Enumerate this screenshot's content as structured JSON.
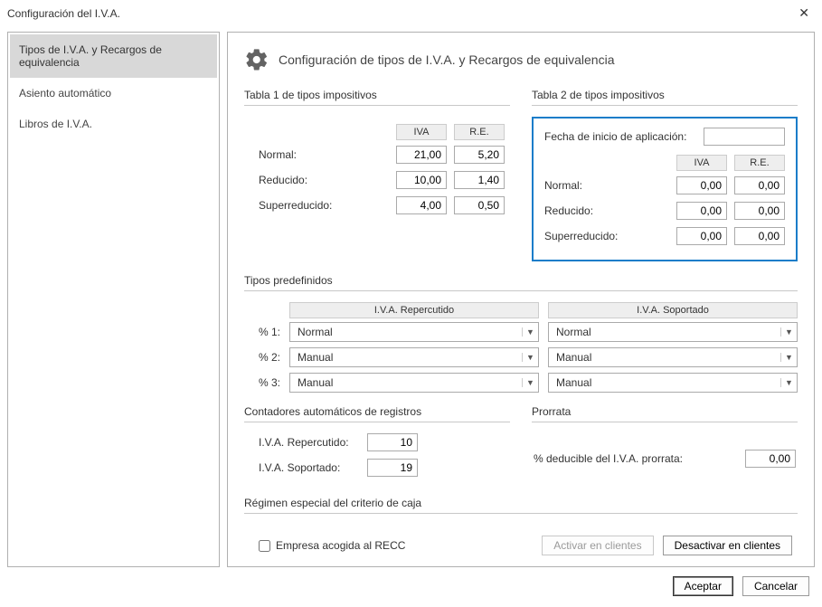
{
  "window": {
    "title": "Configuración del I.V.A."
  },
  "sidebar": {
    "items": [
      {
        "label": "Tipos de I.V.A. y Recargos de equivalencia",
        "selected": true
      },
      {
        "label": "Asiento automático",
        "selected": false
      },
      {
        "label": "Libros de I.V.A.",
        "selected": false
      }
    ]
  },
  "header": {
    "title": "Configuración de tipos de I.V.A. y Recargos de equivalencia"
  },
  "table1": {
    "title": "Tabla 1 de tipos impositivos",
    "cols": {
      "iva": "IVA",
      "re": "R.E."
    },
    "rows": {
      "normal": {
        "label": "Normal:",
        "iva": "21,00",
        "re": "5,20"
      },
      "reducido": {
        "label": "Reducido:",
        "iva": "10,00",
        "re": "1,40"
      },
      "super": {
        "label": "Superreducido:",
        "iva": "4,00",
        "re": "0,50"
      }
    }
  },
  "table2": {
    "title": "Tabla 2 de tipos impositivos",
    "start_label": "Fecha de inicio de aplicación:",
    "start_value": "",
    "cols": {
      "iva": "IVA",
      "re": "R.E."
    },
    "rows": {
      "normal": {
        "label": "Normal:",
        "iva": "0,00",
        "re": "0,00"
      },
      "reducido": {
        "label": "Reducido:",
        "iva": "0,00",
        "re": "0,00"
      },
      "super": {
        "label": "Superreducido:",
        "iva": "0,00",
        "re": "0,00"
      }
    }
  },
  "predef": {
    "title": "Tipos predefinidos",
    "col_repercutido": "I.V.A. Repercutido",
    "col_soportado": "I.V.A. Soportado",
    "rows": {
      "r1": {
        "label": "% 1:",
        "rep": "Normal",
        "sop": "Normal"
      },
      "r2": {
        "label": "% 2:",
        "rep": "Manual",
        "sop": "Manual"
      },
      "r3": {
        "label": "% 3:",
        "rep": "Manual",
        "sop": "Manual"
      }
    }
  },
  "counters": {
    "title": "Contadores automáticos de registros",
    "repercutido_label": "I.V.A. Repercutido:",
    "repercutido_value": "10",
    "soportado_label": "I.V.A. Soportado:",
    "soportado_value": "19"
  },
  "prorrata": {
    "title": "Prorrata",
    "label": "% deducible del I.V.A. prorrata:",
    "value": "0,00"
  },
  "recc": {
    "title": "Régimen especial del criterio de caja",
    "checkbox_label": "Empresa acogida al RECC",
    "checked": false,
    "activate_label": "Activar en clientes",
    "deactivate_label": "Desactivar en clientes"
  },
  "footer": {
    "accept": "Aceptar",
    "cancel": "Cancelar"
  }
}
